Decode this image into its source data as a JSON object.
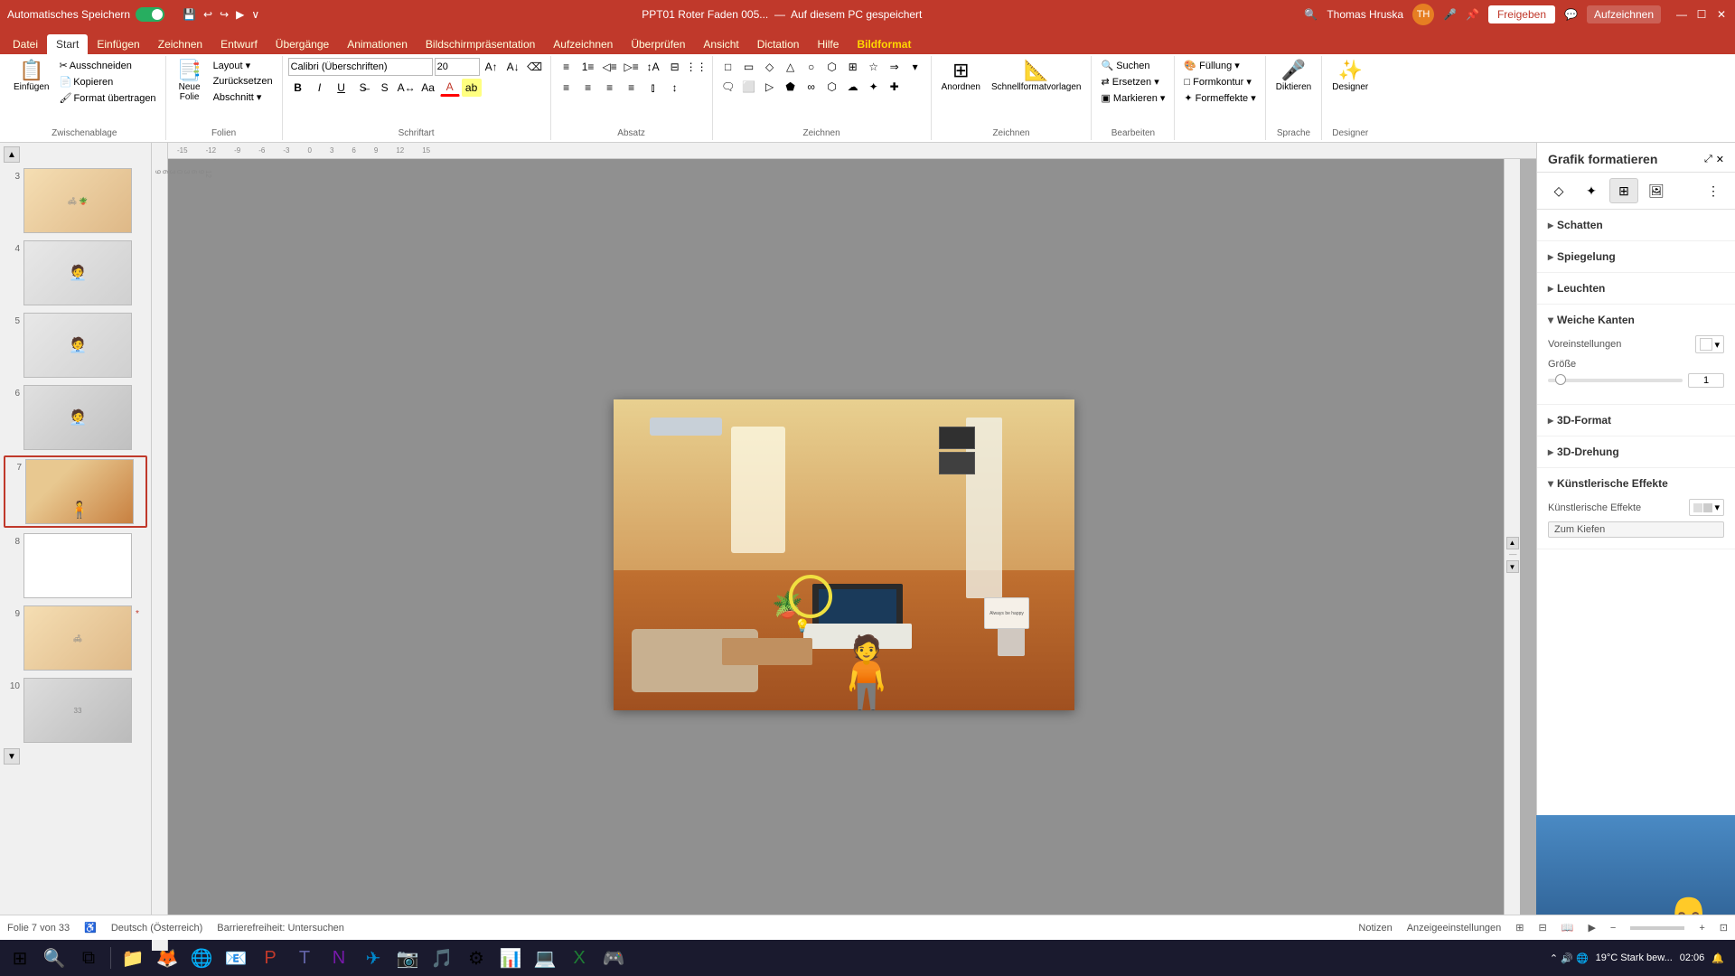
{
  "titlebar": {
    "autosave_label": "Automatisches Speichern",
    "file_name": "PPT01 Roter Faden 005...",
    "save_location": "Auf diesem PC gespeichert",
    "user_name": "Thomas Hruska",
    "user_initials": "TH"
  },
  "ribbon": {
    "tabs": [
      {
        "id": "datei",
        "label": "Datei"
      },
      {
        "id": "start",
        "label": "Start",
        "active": true
      },
      {
        "id": "einfuegen",
        "label": "Einfügen"
      },
      {
        "id": "zeichnen",
        "label": "Zeichnen"
      },
      {
        "id": "entwurf",
        "label": "Entwurf"
      },
      {
        "id": "uebergaenge",
        "label": "Übergänge"
      },
      {
        "id": "animationen",
        "label": "Animationen"
      },
      {
        "id": "praesentation",
        "label": "Bildschirmpräsentation"
      },
      {
        "id": "aufzeichnen",
        "label": "Aufzeichnen"
      },
      {
        "id": "ueberpruefen",
        "label": "Überprüfen"
      },
      {
        "id": "ansicht",
        "label": "Ansicht"
      },
      {
        "id": "dictation",
        "label": "Dictation"
      },
      {
        "id": "hilfe",
        "label": "Hilfe"
      },
      {
        "id": "bildformat",
        "label": "Bildformat",
        "highlight": true
      }
    ],
    "groups": {
      "zwischenablage": {
        "label": "Zwischenablage",
        "buttons": [
          "Einfügen",
          "Ausschneiden",
          "Kopieren",
          "Format übertragen"
        ]
      },
      "folien": {
        "label": "Folien",
        "buttons": [
          "Neue Folie",
          "Layout",
          "Zurücksetzen",
          "Abschnitt"
        ]
      },
      "schriftart": {
        "label": "Schriftart",
        "font": "Calibri (Überschriften)",
        "size": "20"
      }
    }
  },
  "slides": [
    {
      "num": "3",
      "active": false
    },
    {
      "num": "4",
      "active": false
    },
    {
      "num": "5",
      "active": false
    },
    {
      "num": "6",
      "active": false
    },
    {
      "num": "7",
      "active": true
    },
    {
      "num": "8",
      "active": false
    },
    {
      "num": "9",
      "active": false,
      "star": "*"
    },
    {
      "num": "10",
      "active": false
    }
  ],
  "right_panel": {
    "title": "Grafik formatieren",
    "sections": [
      {
        "id": "schatten",
        "label": "Schatten",
        "open": false
      },
      {
        "id": "spiegelung",
        "label": "Spiegelung",
        "open": false
      },
      {
        "id": "leuchten",
        "label": "Leuchten",
        "open": false
      },
      {
        "id": "weiche_kanten",
        "label": "Weiche Kanten",
        "open": true
      },
      {
        "id": "3d_format",
        "label": "3D-Format",
        "open": false
      },
      {
        "id": "3d_drehung",
        "label": "3D-Drehung",
        "open": false
      },
      {
        "id": "kuenstlerische_effekte",
        "label": "Künstlerische Effekte",
        "open": true
      }
    ],
    "weiche_kanten": {
      "voreinstellungen_label": "Voreinstellungen",
      "groesse_label": "Größe",
      "groesse_value": "1"
    },
    "kuenstlerische_effekte": {
      "label": "Künstlerische Effekte",
      "btn_label": "Zum Kiefen"
    }
  },
  "statusbar": {
    "slide_info": "Folie 7 von 33",
    "language": "Deutsch (Österreich)",
    "accessibility": "Barrierefreiheit: Untersuchen",
    "notizen": "Notizen",
    "anzeigeeinstellungen": "Anzeigeeinstellungen"
  },
  "taskbar": {
    "weather": "19°C  Stark bew..."
  }
}
